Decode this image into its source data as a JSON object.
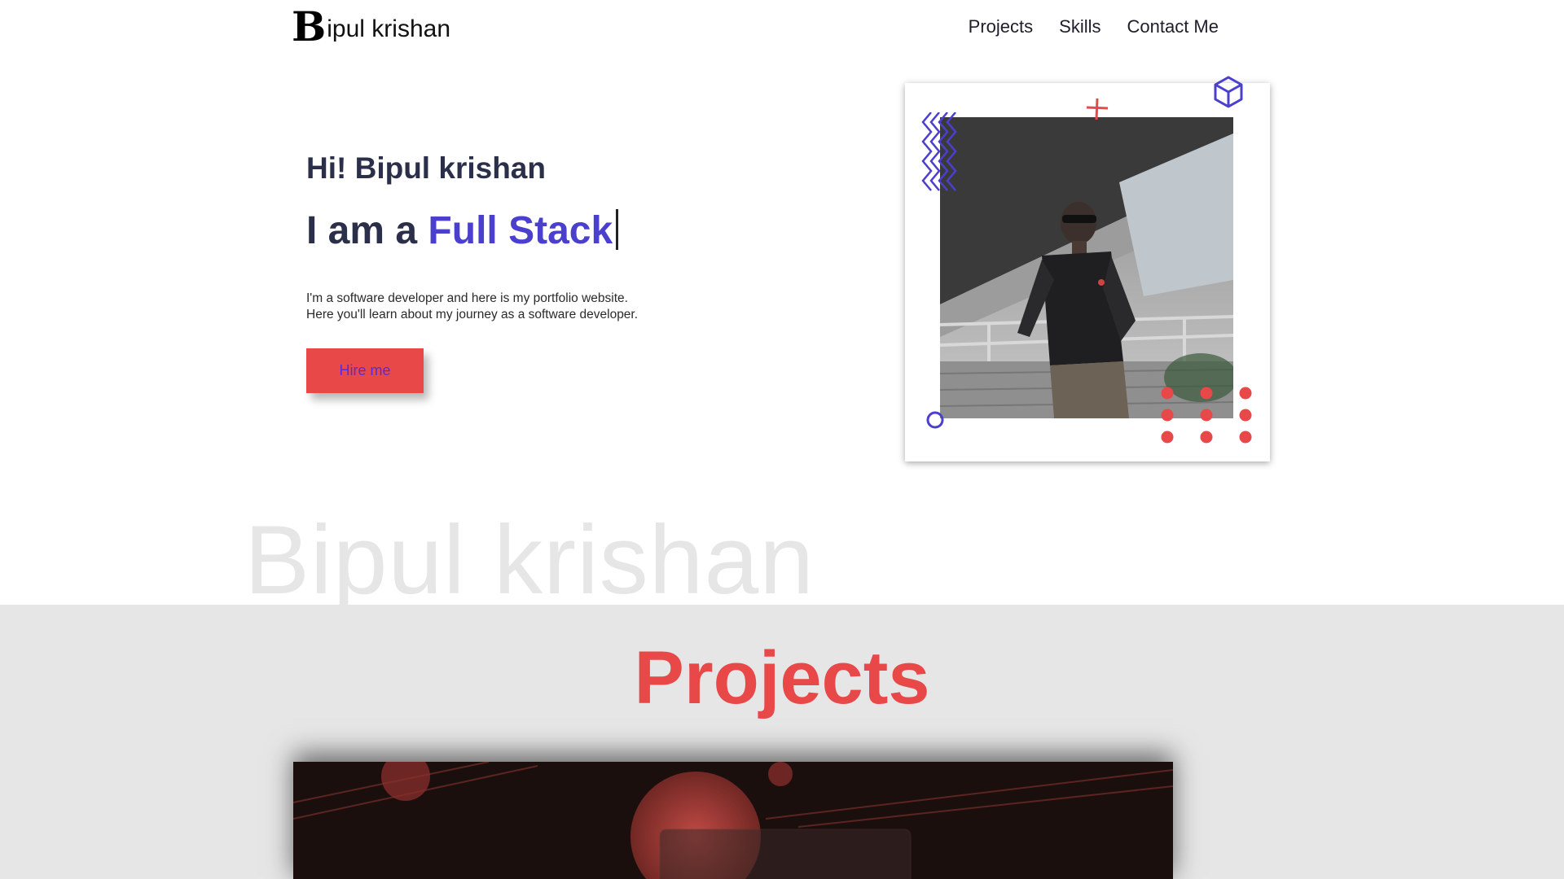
{
  "nav": {
    "logo_initial": "B",
    "logo_rest": "ipul krishan",
    "links": [
      "Projects",
      "Skills",
      "Contact Me"
    ]
  },
  "hero": {
    "greeting": "Hi! Bipul krishan",
    "role_prefix": "I am a ",
    "role_highlight": "Full Stack",
    "description_line1": "I'm a software developer and here is my portfolio website.",
    "description_line2": "Here you'll learn about my journey as a software developer.",
    "cta_label": "Hire me"
  },
  "watermark": "Bipul krishan",
  "projects": {
    "title": "Projects"
  },
  "colors": {
    "accent_red": "#e84848",
    "accent_purple": "#4b3fce",
    "section_gray": "#e6e6e6"
  }
}
